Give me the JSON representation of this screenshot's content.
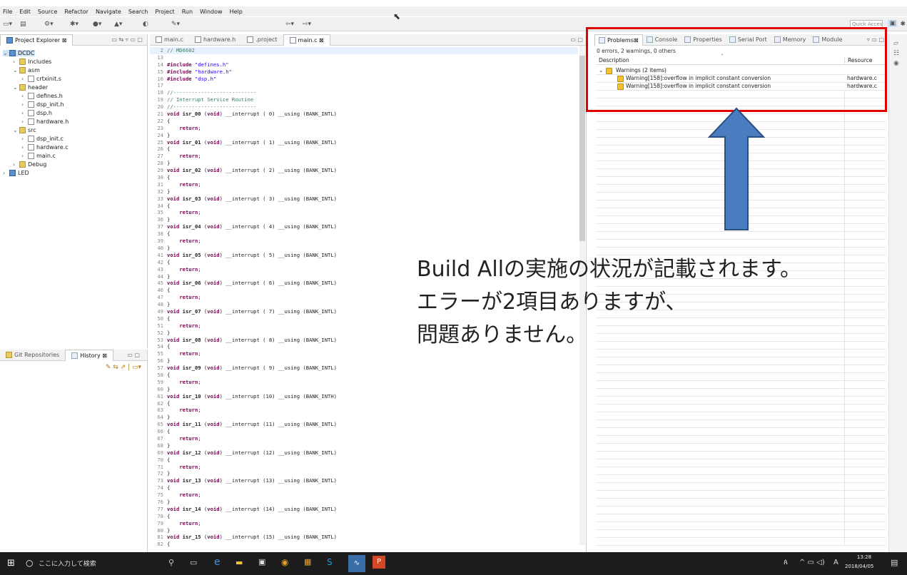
{
  "menu": [
    "File",
    "Edit",
    "Source",
    "Refactor",
    "Navigate",
    "Search",
    "Project",
    "Run",
    "Window",
    "Help"
  ],
  "toolbar": {
    "quick_access": "Quick Access"
  },
  "explorer": {
    "tabs": [
      "Project Explorer"
    ],
    "items": [
      {
        "label": "DCDC",
        "icon": "project-icon"
      },
      {
        "label": "Includes",
        "icon": "includes-icon"
      },
      {
        "label": "asm",
        "icon": "folder-icon"
      },
      {
        "label": "crtxinit.s",
        "icon": "file-icon"
      },
      {
        "label": "header",
        "icon": "folder-icon"
      },
      {
        "label": "defines.h",
        "icon": "file-icon"
      },
      {
        "label": "dsp_init.h",
        "icon": "file-icon"
      },
      {
        "label": "dsp.h",
        "icon": "file-icon"
      },
      {
        "label": "hardware.h",
        "icon": "file-icon"
      },
      {
        "label": "src",
        "icon": "folder-icon"
      },
      {
        "label": "dsp_init.c",
        "icon": "file-icon"
      },
      {
        "label": "hardware.c",
        "icon": "file-icon"
      },
      {
        "label": "main.c",
        "icon": "file-icon"
      },
      {
        "label": "Debug",
        "icon": "folder-icon"
      },
      {
        "label": "LED",
        "icon": "project-icon"
      }
    ]
  },
  "history": {
    "tabs": [
      "Git Repositories",
      "History"
    ]
  },
  "editor": {
    "tabs": [
      "main.c",
      "hardware.h",
      ".project",
      "main.c"
    ],
    "lines": [
      {
        "n": "2",
        "t": "// MD6602",
        "c": "cm"
      },
      {
        "n": "13",
        "t": "",
        "c": ""
      },
      {
        "n": "14",
        "t": "#include \"defines.h\"",
        "c": ""
      },
      {
        "n": "15",
        "t": "#include \"hardware.h\"",
        "c": ""
      },
      {
        "n": "16",
        "t": "#include \"dsp.h\"",
        "c": ""
      },
      {
        "n": "17",
        "t": "",
        "c": ""
      },
      {
        "n": "18",
        "t": "//---------------------------",
        "c": "cm"
      },
      {
        "n": "19",
        "t": "// Interrupt Service Routine",
        "c": "cm"
      },
      {
        "n": "20",
        "t": "//---------------------------",
        "c": "cm"
      },
      {
        "n": "21",
        "t": "void isr_00 (void) __interrupt ( 0) __using (BANK_INTL)",
        "c": ""
      },
      {
        "n": "22",
        "t": "{",
        "c": ""
      },
      {
        "n": "23",
        "t": "    return;",
        "c": ""
      },
      {
        "n": "24",
        "t": "}",
        "c": ""
      },
      {
        "n": "25",
        "t": "void isr_01 (void) __interrupt ( 1) __using (BANK_INTL)",
        "c": ""
      },
      {
        "n": "26",
        "t": "{",
        "c": ""
      },
      {
        "n": "27",
        "t": "    return;",
        "c": ""
      },
      {
        "n": "28",
        "t": "}",
        "c": ""
      },
      {
        "n": "29",
        "t": "void isr_02 (void) __interrupt ( 2) __using (BANK_INTL)",
        "c": ""
      },
      {
        "n": "30",
        "t": "{",
        "c": ""
      },
      {
        "n": "31",
        "t": "    return;",
        "c": ""
      },
      {
        "n": "32",
        "t": "}",
        "c": ""
      },
      {
        "n": "33",
        "t": "void isr_03 (void) __interrupt ( 3) __using (BANK_INTL)",
        "c": ""
      },
      {
        "n": "34",
        "t": "{",
        "c": ""
      },
      {
        "n": "35",
        "t": "    return;",
        "c": ""
      },
      {
        "n": "36",
        "t": "}",
        "c": ""
      },
      {
        "n": "37",
        "t": "void isr_04 (void) __interrupt ( 4) __using (BANK_INTL)",
        "c": ""
      },
      {
        "n": "38",
        "t": "{",
        "c": ""
      },
      {
        "n": "39",
        "t": "    return;",
        "c": ""
      },
      {
        "n": "40",
        "t": "}",
        "c": ""
      },
      {
        "n": "41",
        "t": "void isr_05 (void) __interrupt ( 5) __using (BANK_INTL)",
        "c": ""
      },
      {
        "n": "42",
        "t": "{",
        "c": ""
      },
      {
        "n": "43",
        "t": "    return;",
        "c": ""
      },
      {
        "n": "44",
        "t": "}",
        "c": ""
      },
      {
        "n": "45",
        "t": "void isr_06 (void) __interrupt ( 6) __using (BANK_INTL)",
        "c": ""
      },
      {
        "n": "46",
        "t": "{",
        "c": ""
      },
      {
        "n": "47",
        "t": "    return;",
        "c": ""
      },
      {
        "n": "48",
        "t": "}",
        "c": ""
      },
      {
        "n": "49",
        "t": "void isr_07 (void) __interrupt ( 7) __using (BANK_INTL)",
        "c": ""
      },
      {
        "n": "50",
        "t": "{",
        "c": ""
      },
      {
        "n": "51",
        "t": "    return;",
        "c": ""
      },
      {
        "n": "52",
        "t": "}",
        "c": ""
      },
      {
        "n": "53",
        "t": "void isr_08 (void) __interrupt ( 8) __using (BANK_INTL)",
        "c": ""
      },
      {
        "n": "54",
        "t": "{",
        "c": ""
      },
      {
        "n": "55",
        "t": "    return;",
        "c": ""
      },
      {
        "n": "56",
        "t": "}",
        "c": ""
      },
      {
        "n": "57",
        "t": "void isr_09 (void) __interrupt ( 9) __using (BANK_INTL)",
        "c": ""
      },
      {
        "n": "58",
        "t": "{",
        "c": ""
      },
      {
        "n": "59",
        "t": "    return;",
        "c": ""
      },
      {
        "n": "60",
        "t": "}",
        "c": ""
      },
      {
        "n": "61",
        "t": "void isr_10 (void) __interrupt (10) __using (BANK_INTH)",
        "c": ""
      },
      {
        "n": "62",
        "t": "{",
        "c": ""
      },
      {
        "n": "63",
        "t": "    return;",
        "c": ""
      },
      {
        "n": "64",
        "t": "}",
        "c": ""
      },
      {
        "n": "65",
        "t": "void isr_11 (void) __interrupt (11) __using (BANK_INTL)",
        "c": ""
      },
      {
        "n": "66",
        "t": "{",
        "c": ""
      },
      {
        "n": "67",
        "t": "    return;",
        "c": ""
      },
      {
        "n": "68",
        "t": "}",
        "c": ""
      },
      {
        "n": "69",
        "t": "void isr_12 (void) __interrupt (12) __using (BANK_INTL)",
        "c": ""
      },
      {
        "n": "70",
        "t": "{",
        "c": ""
      },
      {
        "n": "71",
        "t": "    return;",
        "c": ""
      },
      {
        "n": "72",
        "t": "}",
        "c": ""
      },
      {
        "n": "73",
        "t": "void isr_13 (void) __interrupt (13) __using (BANK_INTL)",
        "c": ""
      },
      {
        "n": "74",
        "t": "{",
        "c": ""
      },
      {
        "n": "75",
        "t": "    return;",
        "c": ""
      },
      {
        "n": "76",
        "t": "}",
        "c": ""
      },
      {
        "n": "77",
        "t": "void isr_14 (void) __interrupt (14) __using (BANK_INTL)",
        "c": ""
      },
      {
        "n": "78",
        "t": "{",
        "c": ""
      },
      {
        "n": "79",
        "t": "    return;",
        "c": ""
      },
      {
        "n": "80",
        "t": "}",
        "c": ""
      },
      {
        "n": "81",
        "t": "void isr_15 (void) __interrupt (15) __using (BANK_INTL)",
        "c": ""
      },
      {
        "n": "82",
        "t": "{",
        "c": ""
      }
    ]
  },
  "problems": {
    "tabs": [
      "Problems",
      "Console",
      "Properties",
      "Serial Port",
      "Memory",
      "Module"
    ],
    "summary": "0 errors, 2 warnings, 0 others",
    "columns": [
      "Description",
      "Resource"
    ],
    "group": "Warnings (2 items)",
    "rows": [
      {
        "desc": "Warning[158]:overflow in implicit constant conversion",
        "res": "hardware.c"
      },
      {
        "desc": "Warning[158]:overflow in implicit constant conversion",
        "res": "hardware.c"
      }
    ]
  },
  "callout": {
    "line1": "Build Allの実施の状況が記載されます。",
    "line2": "エラーが2項目ありますが、",
    "line3": "問題ありません。"
  },
  "taskbar": {
    "search": "ここに入力して検索",
    "time": "13:28",
    "date": "2018/04/05",
    "ime": "A"
  },
  "colors": {
    "highlight_box": "#e00000",
    "arrow": "#4a7cc0",
    "arrow_border": "#2a4f80"
  }
}
